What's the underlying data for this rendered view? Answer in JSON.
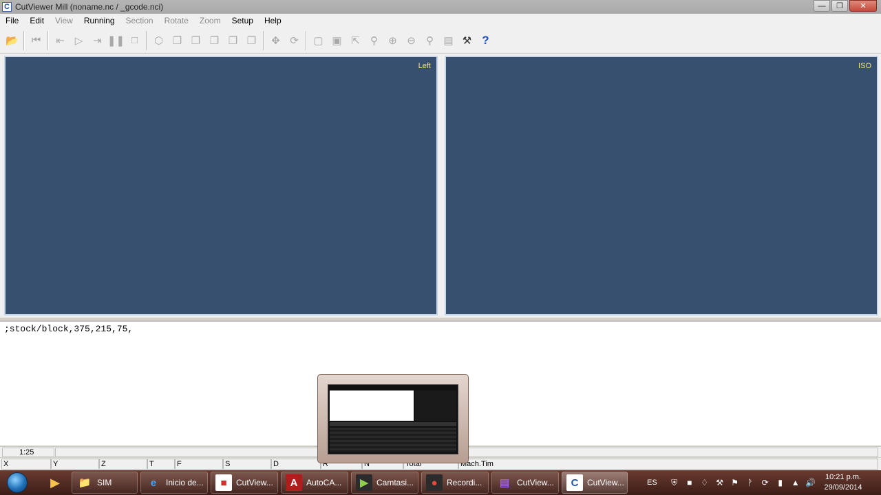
{
  "window": {
    "title": "CutViewer Mill (noname.nc / _gcode.nci)"
  },
  "menu": [
    {
      "label": "File",
      "enabled": true
    },
    {
      "label": "Edit",
      "enabled": true
    },
    {
      "label": "View",
      "enabled": false
    },
    {
      "label": "Running",
      "enabled": true
    },
    {
      "label": "Section",
      "enabled": false
    },
    {
      "label": "Rotate",
      "enabled": false
    },
    {
      "label": "Zoom",
      "enabled": false
    },
    {
      "label": "Setup",
      "enabled": true
    },
    {
      "label": "Help",
      "enabled": true
    }
  ],
  "toolbar": {
    "icons": [
      "open-icon",
      "rewind-icon",
      "step-back-icon",
      "play-icon",
      "step-forward-icon",
      "pause-icon",
      "stop-icon",
      "view-iso-icon",
      "view-front-icon",
      "view-back-icon",
      "view-left-icon",
      "view-right-icon",
      "view-top-icon",
      "pan-icon",
      "rotate-icon",
      "zoom-window-icon",
      "zoom-fit-icon",
      "zoom-extents-icon",
      "zoom-icon",
      "zoom-in-icon",
      "zoom-out-icon",
      "measure-icon",
      "ruler-icon",
      "setup-tools-icon",
      "help-icon"
    ]
  },
  "viewports": {
    "left": {
      "label": "Left"
    },
    "right": {
      "label": "ISO"
    },
    "background": "#375070",
    "label_color": "#f3e27a"
  },
  "editor": {
    "line": ";stock/block,375,215,75,"
  },
  "status": {
    "time": "1:25",
    "axes": [
      "X",
      "Y",
      "Z",
      "T",
      "F",
      "S",
      "D",
      "R",
      "N",
      "Total",
      "Mach.Tim"
    ]
  },
  "taskbar": {
    "items": [
      {
        "label": "SIM",
        "icon": "folder-icon"
      },
      {
        "label": "Inicio de...",
        "icon": "ie-icon"
      },
      {
        "label": "CutView...",
        "icon": "pdf-icon"
      },
      {
        "label": "AutoCA...",
        "icon": "autocad-icon"
      },
      {
        "label": "Camtasi...",
        "icon": "camtasia-icon"
      },
      {
        "label": "Recordi...",
        "icon": "recording-icon"
      },
      {
        "label": "CutView...",
        "icon": "winrar-icon"
      },
      {
        "label": "CutView...",
        "icon": "cutviewer-icon"
      }
    ],
    "tray": {
      "lang": "ES",
      "time": "10:21 p.m.",
      "date": "29/09/2014"
    }
  }
}
